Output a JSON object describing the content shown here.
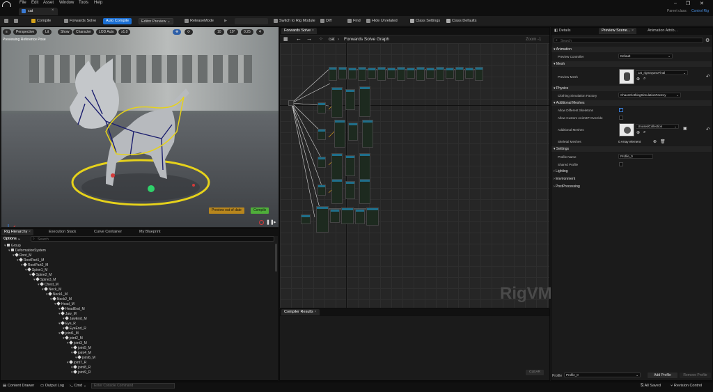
{
  "menu": {
    "items": [
      "File",
      "Edit",
      "Asset",
      "Window",
      "Tools",
      "Help"
    ]
  },
  "window": {
    "parent_class_label": "Parent class:",
    "parent_class_value": "Control Rig"
  },
  "document_tab": {
    "label": "cat"
  },
  "toolbar": {
    "compile": "Compile",
    "forwards_solve": "Forwards Solve",
    "auto_compile": "Auto Compile",
    "editor_preview": "Editor Preview",
    "release_mode": "ReleaseMode",
    "switch_to_rig_module": "Switch to Rig Module",
    "diff": "Diff",
    "find": "Find",
    "hide_unrelated": "Hide Unrelated",
    "class_settings": "Class Settings",
    "class_defaults": "Class Defaults"
  },
  "viewport": {
    "buttons": [
      "Perspective",
      "Lit",
      "Show",
      "Character",
      "LOD Auto",
      "x1.0"
    ],
    "snap_values": [
      "10",
      "10°",
      "0.25",
      "4"
    ],
    "preview_label": "Previewing Reference Pose",
    "preview_out_of_date": "Preview out of date",
    "compile_button": "Compile"
  },
  "bottom_left_tabs": [
    "Rig Hierarchy",
    "Execution Stack",
    "Curve Container",
    "My Blueprint"
  ],
  "hierarchy": {
    "options_label": "Options",
    "search_placeholder": "Search",
    "items": [
      {
        "label": "Group",
        "depth": 0,
        "kind": "group"
      },
      {
        "label": "DeformationSystem",
        "depth": 1,
        "kind": "group"
      },
      {
        "label": "Root_M",
        "depth": 2,
        "kind": "bone"
      },
      {
        "label": "RootPart1_M",
        "depth": 3,
        "kind": "bone"
      },
      {
        "label": "RootPart2_M",
        "depth": 4,
        "kind": "bone"
      },
      {
        "label": "Spine1_M",
        "depth": 5,
        "kind": "bone"
      },
      {
        "label": "Spine2_M",
        "depth": 6,
        "kind": "bone"
      },
      {
        "label": "Spine3_M",
        "depth": 7,
        "kind": "bone"
      },
      {
        "label": "Chest_M",
        "depth": 8,
        "kind": "bone"
      },
      {
        "label": "Neck_M",
        "depth": 9,
        "kind": "bone"
      },
      {
        "label": "Neck1_M",
        "depth": 10,
        "kind": "bone"
      },
      {
        "label": "Neck2_M",
        "depth": 11,
        "kind": "bone"
      },
      {
        "label": "Head_M",
        "depth": 12,
        "kind": "bone"
      },
      {
        "label": "HeadEnd_M",
        "depth": 13,
        "kind": "bone"
      },
      {
        "label": "Jaw_M",
        "depth": 13,
        "kind": "bone"
      },
      {
        "label": "JawEnd_M",
        "depth": 14,
        "kind": "bone"
      },
      {
        "label": "Eye_R",
        "depth": 13,
        "kind": "bone"
      },
      {
        "label": "EyeEnd_R",
        "depth": 14,
        "kind": "bone"
      },
      {
        "label": "joint1_M",
        "depth": 13,
        "kind": "bone"
      },
      {
        "label": "joint2_M",
        "depth": 14,
        "kind": "bone"
      },
      {
        "label": "joint3_M",
        "depth": 15,
        "kind": "bone"
      },
      {
        "label": "joint5_M",
        "depth": 16,
        "kind": "bone"
      },
      {
        "label": "joint4_M",
        "depth": 16,
        "kind": "bone"
      },
      {
        "label": "joint6_M",
        "depth": 17,
        "kind": "bone"
      },
      {
        "label": "joint7_R",
        "depth": 15,
        "kind": "bone"
      },
      {
        "label": "joint8_R",
        "depth": 16,
        "kind": "bone"
      },
      {
        "label": "joint9_R",
        "depth": 16,
        "kind": "bone"
      }
    ]
  },
  "graph": {
    "tab": "Forwards Solve",
    "breadcrumb_root": "cat",
    "breadcrumb_graph": "Forwards Solve Graph",
    "zoom": "Zoom -1",
    "watermark": "RigVM"
  },
  "compiler_results": {
    "tab": "Compiler Results",
    "clear": "CLEAR"
  },
  "details": {
    "tabs": [
      "Details",
      "Preview Scene...",
      "Animation Attrib..."
    ],
    "search_placeholder": "Search",
    "sections": {
      "animation": "Animation",
      "mesh": "Mesh",
      "physics": "Physics",
      "additional_meshes": "Additional Meshes",
      "settings": "Settings",
      "lighting": "Lighting",
      "environment": "Environment",
      "postprocessing": "PostProcessing"
    },
    "props": {
      "preview_controller_label": "Preview Controller",
      "preview_controller_value": "Default",
      "preview_mesh_label": "Preview Mesh",
      "preview_mesh_value": "cat_rigmayanoFinal",
      "clothing_label": "Clothing Simulation Factory",
      "clothing_value": "ChaosClothingSimulationFactory",
      "allow_diff_skel_label": "Allow Different Skeletons",
      "allow_custom_label": "Allow Custom AnimBP Override",
      "additional_meshes_label": "Additional Meshes",
      "additional_meshes_value": "UnusedCollection",
      "skeletal_meshes_label": "Skeletal Meshes",
      "skeletal_meshes_value": "0 Array element",
      "profile_name_label": "Profile Name",
      "profile_name_value": "Profile_0",
      "shared_profile_label": "Shared Profile"
    },
    "profile_label": "Profile",
    "profile_value": "Profile_0",
    "add_profile": "Add Profile",
    "remove_profile": "Remove Profile"
  },
  "status": {
    "content_drawer": "Content Drawer",
    "output_log": "Output Log",
    "cmd": "Cmd",
    "console_placeholder": "Enter Console Command",
    "all_saved": "All Saved",
    "revision_control": "Revision Control"
  },
  "colors": {
    "accent": "#1a6fd4",
    "node_header": "#1f6f8b",
    "gizmo_yellow": "#e6d21b"
  }
}
